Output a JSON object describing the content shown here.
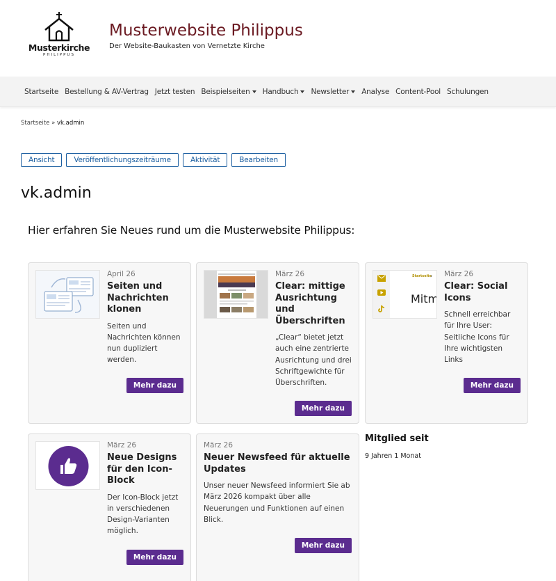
{
  "header": {
    "logo_text": "Musterkirche",
    "logo_sub": "PHILIPPUS",
    "site_title": "Musterwebsite Philippus",
    "site_slogan": "Der Website-Baukasten von Vernetzte Kirche"
  },
  "nav": {
    "items": [
      {
        "label": "Startseite",
        "dropdown": false
      },
      {
        "label": "Bestellung & AV-Vertrag",
        "dropdown": false
      },
      {
        "label": "Jetzt testen",
        "dropdown": false
      },
      {
        "label": "Beispielseiten",
        "dropdown": true
      },
      {
        "label": "Handbuch",
        "dropdown": true
      },
      {
        "label": "Newsletter",
        "dropdown": true
      },
      {
        "label": "Analyse",
        "dropdown": false
      },
      {
        "label": "Content-Pool",
        "dropdown": false
      },
      {
        "label": "Schulungen",
        "dropdown": false
      }
    ]
  },
  "breadcrumb": {
    "home": "Startseite",
    "separator": "»",
    "current": "vk.admin"
  },
  "tabs": [
    "Ansicht",
    "Veröffentlichungszeiträume",
    "Aktivität",
    "Bearbeiten"
  ],
  "page_title": "vk.admin",
  "section_heading": "Hier erfahren Sie Neues rund um die Musterwebsite Philippus:",
  "cards": [
    {
      "date": "April 26",
      "title": "Seiten und Nachrichten klonen",
      "desc": "Seiten und Nachrichten können nun dupliziert werden.",
      "button": "Mehr dazu"
    },
    {
      "date": "März 26",
      "title": "Clear: mittige Ausrichtung und Überschriften",
      "desc": "„Clear“ bietet jetzt auch eine zentrierte Ausrichtung und drei Schriftgewichte für Überschriften.",
      "button": "Mehr dazu"
    },
    {
      "date": "März 26",
      "title": "Clear: Social Icons",
      "desc": "Schnell erreichbar für Ihre User: Seitliche Icons für Ihre wichtigsten Links",
      "button": "Mehr dazu",
      "thumb_text": "Mitm",
      "thumb_nav": "Startseite"
    },
    {
      "date": "März 26",
      "title": "Neue Designs für den Icon-Block",
      "desc": "Der Icon-Block jetzt in verschiedenen Design-Varianten möglich.",
      "button": "Mehr dazu"
    },
    {
      "date": "März 26",
      "title": "Neuer Newsfeed für aktuelle Updates",
      "desc": "Unser neuer Newsfeed informiert Sie ab März 2026 kompakt über alle Neuerungen und Funktionen auf einen Blick.",
      "button": "Mehr dazu"
    }
  ],
  "member": {
    "label": "Mitglied seit",
    "value": "9 Jahren 1 Monat"
  },
  "colors": {
    "title": "#6b1a22",
    "button": "#5b2c8f",
    "tab": "#1b5ea0",
    "accent_gold": "#c8a200"
  }
}
